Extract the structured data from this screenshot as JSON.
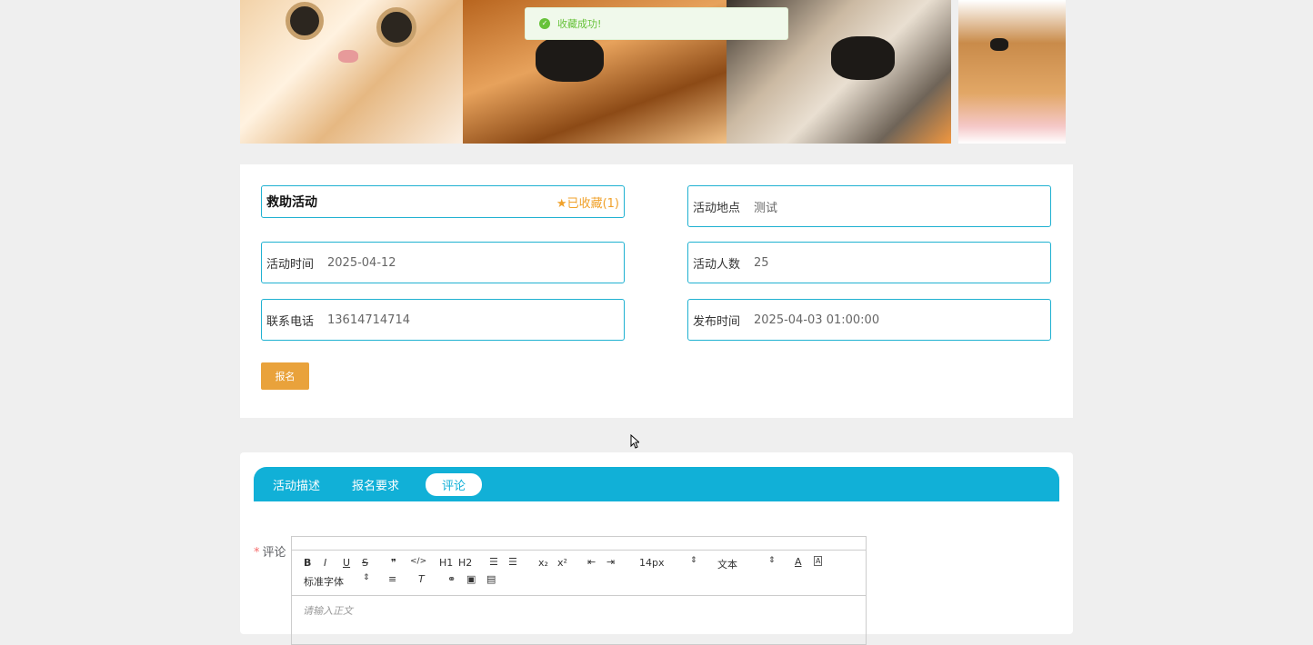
{
  "toast": {
    "message": "收藏成功!"
  },
  "activity": {
    "title": "救助活动",
    "favorite_label": "已收藏(1)",
    "fields": {
      "location": {
        "label": "活动地点",
        "value": "测试"
      },
      "time": {
        "label": "活动时间",
        "value": "2025-04-12"
      },
      "count": {
        "label": "活动人数",
        "value": "25"
      },
      "phone": {
        "label": "联系电话",
        "value": "13614714714"
      },
      "publish": {
        "label": "发布时间",
        "value": "2025-04-03 01:00:00"
      }
    },
    "signup_button": "报名"
  },
  "tabs": [
    {
      "label": "活动描述",
      "active": false
    },
    {
      "label": "报名要求",
      "active": false
    },
    {
      "label": "评论",
      "active": true
    }
  ],
  "comment_form": {
    "label": "评论",
    "toolbar": {
      "bold": "B",
      "italic": "I",
      "underline": "U",
      "strike": "S",
      "quote": "❞",
      "code": "</>",
      "h1": "H1",
      "h2": "H2",
      "sub": "x₂",
      "sup": "x²",
      "font_size": "14px",
      "text_type": "文本",
      "font_family": "标准字体"
    },
    "placeholder": "请输入正文"
  },
  "colors": {
    "accent": "#11b0d7",
    "favorite": "#f0a12a",
    "signup": "#e9a23b",
    "success": "#67c23a"
  }
}
